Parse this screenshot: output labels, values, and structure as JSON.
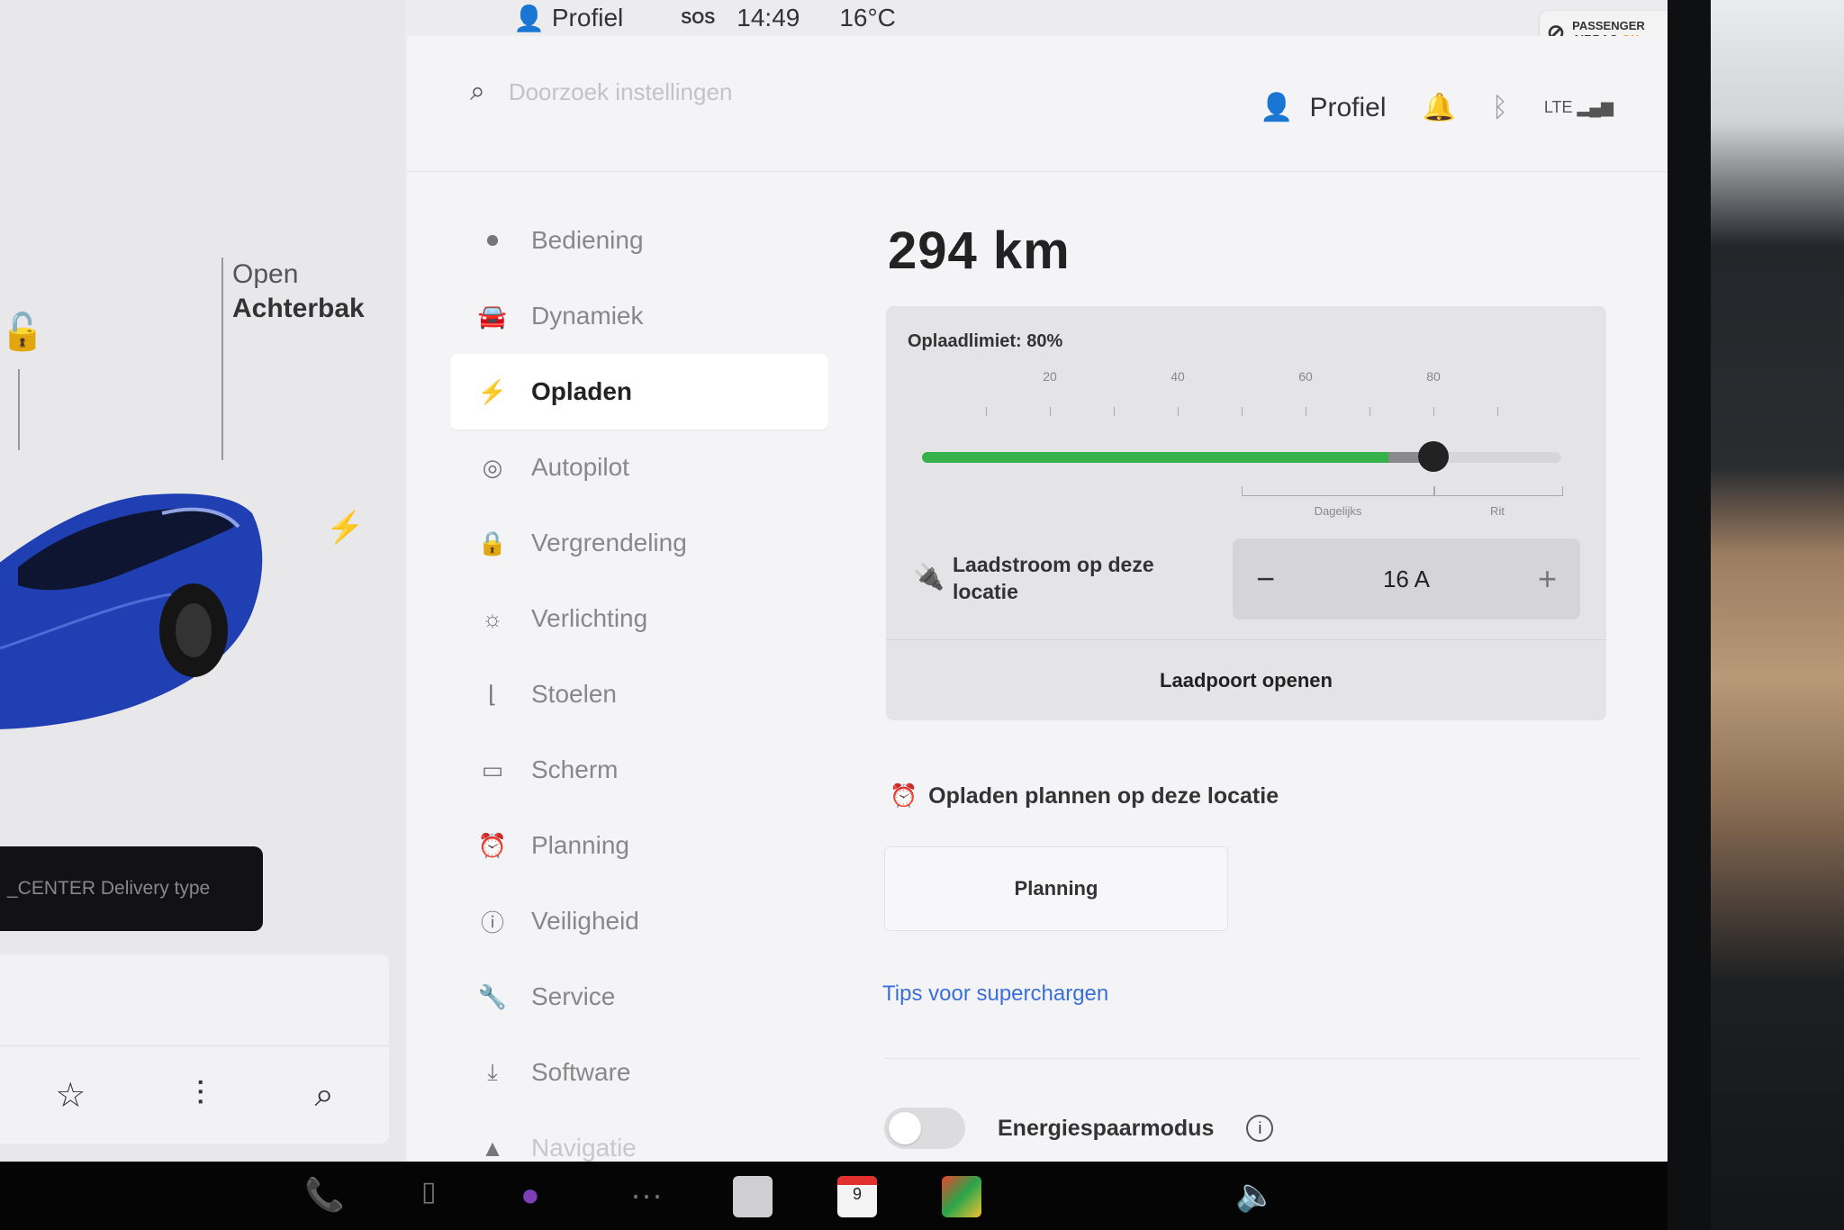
{
  "statusbar": {
    "profile_label": "Profiel",
    "sos_label": "SOS",
    "time": "14:49",
    "temperature": "16°C",
    "airbag_line1": "PASSENGER",
    "airbag_line2": "AIRBAG",
    "airbag_state": "ON"
  },
  "car_panel": {
    "trunk_line1": "Open",
    "trunk_line2": "Achterbak",
    "delivery_text": "_CENTER Delivery type"
  },
  "settings": {
    "search_placeholder": "Doorzoek instellingen",
    "profile_label": "Profiel",
    "nav": [
      {
        "label": "Bediening",
        "icon": "toggle-icon"
      },
      {
        "label": "Dynamiek",
        "icon": "car-icon"
      },
      {
        "label": "Opladen",
        "icon": "bolt-icon",
        "active": true
      },
      {
        "label": "Autopilot",
        "icon": "steering-wheel-icon"
      },
      {
        "label": "Vergrendeling",
        "icon": "lock-icon"
      },
      {
        "label": "Verlichting",
        "icon": "sun-icon"
      },
      {
        "label": "Stoelen",
        "icon": "seat-icon"
      },
      {
        "label": "Scherm",
        "icon": "screen-icon"
      },
      {
        "label": "Planning",
        "icon": "alarm-clock-icon"
      },
      {
        "label": "Veiligheid",
        "icon": "info-circle-icon"
      },
      {
        "label": "Service",
        "icon": "wrench-icon"
      },
      {
        "label": "Software",
        "icon": "download-icon"
      },
      {
        "label": "Navigatie",
        "icon": "navigation-icon"
      }
    ]
  },
  "charging": {
    "range": "294 km",
    "limit_label": "Oplaadlimiet: 80%",
    "limit_percent": 80,
    "current_level_percent": 73,
    "tick_labels": [
      "20",
      "40",
      "60",
      "80"
    ],
    "range_tags": [
      "Dagelijks",
      "Rit"
    ],
    "current_label": "Laadstroom op deze locatie",
    "current_value": "16 A",
    "minus": "−",
    "plus": "+",
    "port_button": "Laadpoort openen",
    "schedule_heading": "Opladen plannen op deze locatie",
    "schedule_button": "Planning",
    "tips_link": "Tips voor superchargen",
    "eco_label": "Energiespaarmodus",
    "eco_enabled": false
  },
  "dock": {
    "calendar_day": "9"
  }
}
